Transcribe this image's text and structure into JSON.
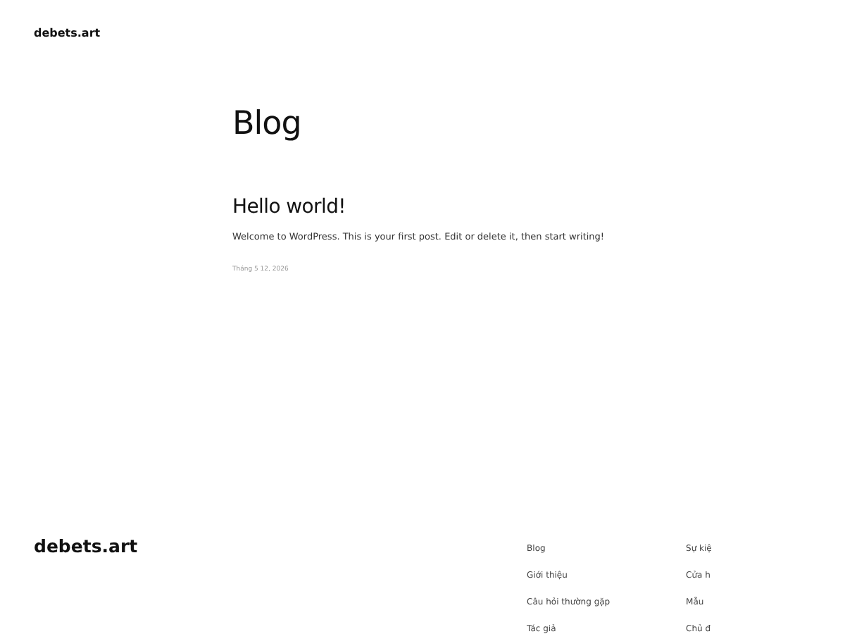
{
  "header": {
    "site_title": "debets.art"
  },
  "page_title": "Blog",
  "posts": [
    {
      "title": "Hello world!",
      "excerpt": "Welcome to WordPress. This is your first post. Edit or delete it, then start writing!",
      "date": "Tháng 5 12, 2026"
    }
  ],
  "footer": {
    "site_title": "debets.art",
    "columns": [
      [
        "Blog",
        "Giới thiệu",
        "Câu hỏi thường gặp",
        "Tác giả"
      ],
      [
        "Sự kiệ",
        "Cửa h",
        "Mẫu",
        "Chủ đ"
      ]
    ]
  }
}
